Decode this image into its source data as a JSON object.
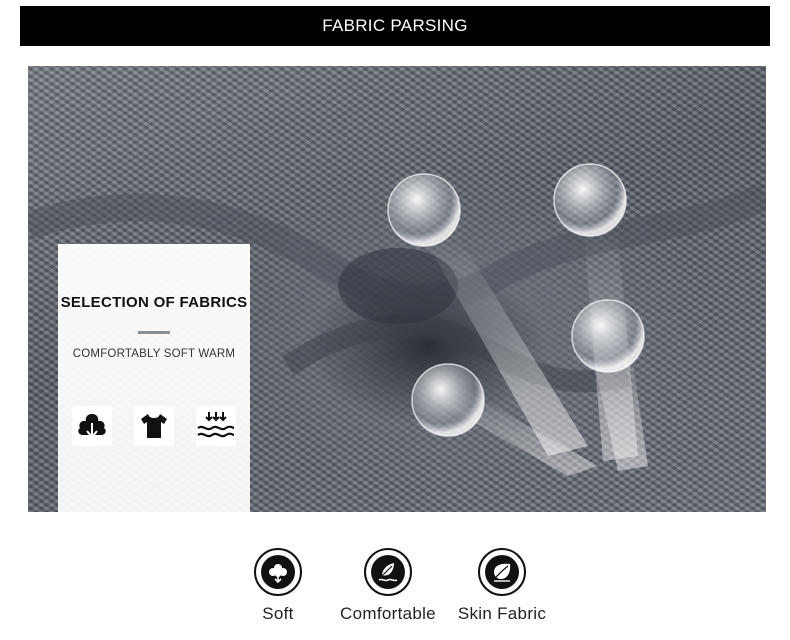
{
  "header": {
    "title": "FABRIC PARSING"
  },
  "card": {
    "title": "SELECTION OF FABRICS",
    "subtitle": "COMFORTABLY SOFT WARM",
    "icons": [
      "cotton-icon",
      "tshirt-icon",
      "warm-waves-icon"
    ]
  },
  "features": [
    {
      "icon": "cotton-flower-icon",
      "label": "Soft"
    },
    {
      "icon": "feather-icon",
      "label": "Comfortable"
    },
    {
      "icon": "leaf-icon",
      "label": "Skin Fabric"
    }
  ],
  "colors": {
    "header_bg": "#000000",
    "header_text": "#ffffff",
    "icon_dark": "#111111"
  }
}
